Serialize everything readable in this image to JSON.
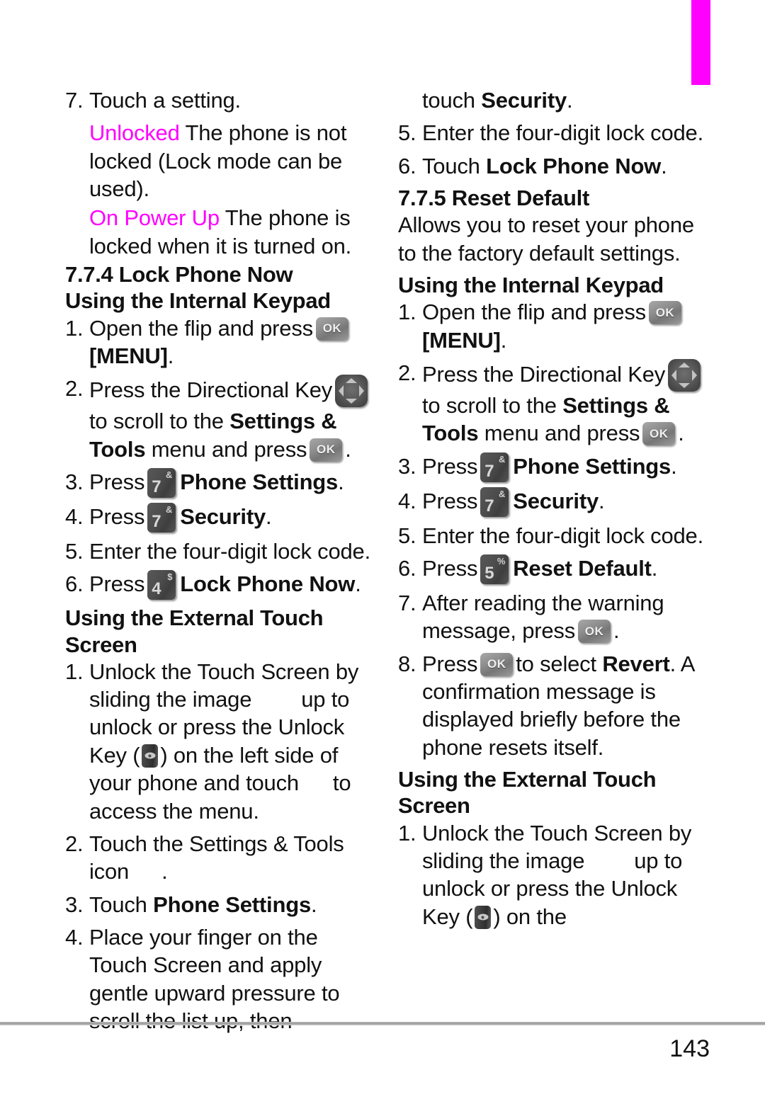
{
  "page": {
    "number": "143",
    "tab_color": "#ff00ff"
  },
  "icons": {
    "ok_key": "ok-key-icon",
    "ok_label": "OK",
    "directional_key": "directional-key-icon",
    "unlock_key": "unlock-key-icon",
    "key_7": {
      "digit": "7",
      "alt": "&"
    },
    "key_4": {
      "digit": "4",
      "alt": "$"
    },
    "key_5": {
      "digit": "5",
      "alt": "%"
    }
  },
  "left_column": {
    "step7": {
      "num": "7.",
      "text": "Touch a setting."
    },
    "definitions": [
      {
        "term": "Unlocked",
        "desc": "The phone is not locked (Lock mode can be used)."
      },
      {
        "term": "On Power Up",
        "desc": "The phone is locked when  it is turned on."
      }
    ],
    "section_heading": "7.7.4 Lock Phone Now",
    "internal_keypad_heading": "Using the Internal Keypad",
    "ik_steps": {
      "s1_num": "1.",
      "s1_a": "Open the flip and press",
      "s1_b": "[MENU]",
      "s1_c": ".",
      "s2_num": "2.",
      "s2_a": "Press the Directional Key",
      "s2_b": "to scroll to the",
      "s2_c": "Settings & Tools",
      "s2_d": "menu and press",
      "s2_e": ".",
      "s3_num": "3.",
      "s3_a": "Press",
      "s3_b": "Phone Settings",
      "s3_c": ".",
      "s4_num": "4.",
      "s4_a": "Press",
      "s4_b": "Security",
      "s4_c": ".",
      "s5_num": "5.",
      "s5_a": "Enter the four-digit lock code.",
      "s6_num": "6.",
      "s6_a": "Press",
      "s6_b": "Lock Phone Now",
      "s6_c": "."
    },
    "touch_screen_heading": "Using the External Touch Screen",
    "ts_steps": {
      "t1_num": "1.",
      "t1_a": "Unlock the Touch Screen by sliding the image",
      "t1_b": "up to unlock or press the Unlock Key (",
      "t1_c": ") on the left side of your phone and touch",
      "t1_d": "to access the menu.",
      "t2_num": "2.",
      "t2_a": "Touch the Settings & Tools icon",
      "t2_b": ".",
      "t3_num": "3.",
      "t3_a": "Touch",
      "t3_b": "Phone Settings",
      "t3_c": ".",
      "t4_num": "4.",
      "t4_a": "Place your finger on the Touch Screen and apply gentle upward pressure to scroll the list up, then"
    }
  },
  "right_column": {
    "continued": {
      "a": "touch",
      "b": "Security",
      "c": "."
    },
    "step5": {
      "num": "5.",
      "text": "Enter the four-digit lock code."
    },
    "step6": {
      "num": "6.",
      "a": "Touch",
      "b": "Lock Phone Now",
      "c": "."
    },
    "section_heading": "7.7.5 Reset Default",
    "intro": "Allows you to reset your phone to the factory default settings.",
    "internal_keypad_heading": "Using the Internal Keypad",
    "ik_steps": {
      "s1_num": "1.",
      "s1_a": "Open the flip and press",
      "s1_b": "[MENU]",
      "s1_c": ".",
      "s2_num": "2.",
      "s2_a": "Press the Directional Key",
      "s2_b": "to scroll to the",
      "s2_c": "Settings & Tools",
      "s2_d": "menu and press",
      "s2_e": ".",
      "s3_num": "3.",
      "s3_a": "Press",
      "s3_b": "Phone Settings",
      "s3_c": ".",
      "s4_num": "4.",
      "s4_a": "Press",
      "s4_b": "Security",
      "s4_c": ".",
      "s5_num": "5.",
      "s5_a": "Enter the four-digit lock code.",
      "s6_num": "6.",
      "s6_a": "Press",
      "s6_b": "Reset Default",
      "s6_c": ".",
      "s7_num": "7.",
      "s7_a": "After reading the warning message, press",
      "s7_b": ".",
      "s8_num": "8.",
      "s8_a": "Press",
      "s8_b": "to select",
      "s8_c": "Revert",
      "s8_d": ".",
      "s8_e": "A confirmation message is displayed briefly before the phone resets itself."
    },
    "touch_screen_heading": "Using the External Touch Screen",
    "ts_steps": {
      "t1_num": "1.",
      "t1_a": "Unlock the Touch Screen by sliding the image",
      "t1_b": "up to unlock or press the Unlock Key (",
      "t1_c": ") on the"
    }
  }
}
